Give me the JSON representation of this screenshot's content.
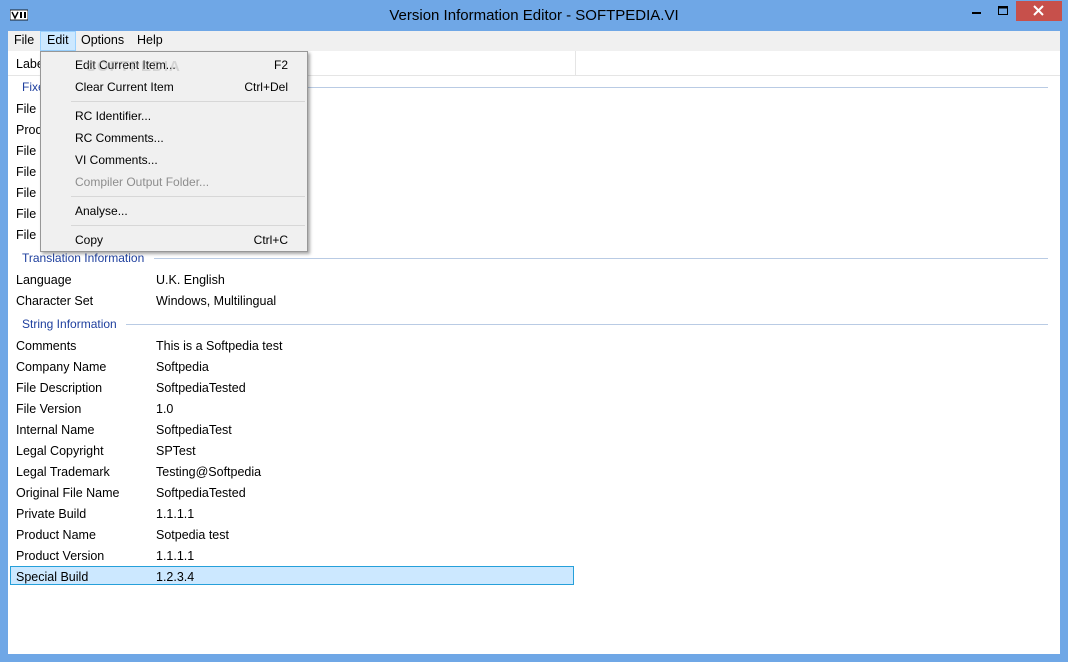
{
  "window": {
    "title": "Version Information Editor - SOFTPEDIA.VI",
    "colors": {
      "frame": "#6fa7e6",
      "close": "#c7504b",
      "group_text": "#1e3f9e",
      "selection": "#cce8ff"
    }
  },
  "menubar": {
    "items": [
      {
        "label": "File"
      },
      {
        "label": "Edit"
      },
      {
        "label": "Options"
      },
      {
        "label": "Help"
      }
    ]
  },
  "edit_menu": {
    "items": [
      {
        "label": "Edit Current Item...",
        "shortcut": "F2"
      },
      {
        "label": "Clear Current Item",
        "shortcut": "Ctrl+Del"
      },
      {
        "label": "RC Identifier...",
        "shortcut": ""
      },
      {
        "label": "RC Comments...",
        "shortcut": ""
      },
      {
        "label": "VI Comments...",
        "shortcut": ""
      },
      {
        "label": "Compiler Output Folder...",
        "shortcut": "",
        "disabled": true
      },
      {
        "label": "Analyse...",
        "shortcut": ""
      },
      {
        "label": "Copy",
        "shortcut": "Ctrl+C"
      }
    ]
  },
  "list": {
    "header_label": "Label",
    "fixed": {
      "title": "Fixed Information",
      "labels": [
        "File",
        "Product",
        "File",
        "File",
        "File",
        "File",
        "File"
      ]
    },
    "translation": {
      "title": "Translation Information",
      "rows": [
        {
          "label": "Language",
          "value": "U.K. English"
        },
        {
          "label": "Character Set",
          "value": "Windows, Multilingual"
        }
      ]
    },
    "strings": {
      "title": "String Information",
      "rows": [
        {
          "label": "Comments",
          "value": "This is a Softpedia test"
        },
        {
          "label": "Company Name",
          "value": "Softpedia"
        },
        {
          "label": "File Description",
          "value": "SoftpediaTested"
        },
        {
          "label": "File Version",
          "value": "1.0"
        },
        {
          "label": "Internal Name",
          "value": "SoftpediaTest"
        },
        {
          "label": "Legal Copyright",
          "value": "SPTest"
        },
        {
          "label": "Legal Trademark",
          "value": "Testing@Softpedia"
        },
        {
          "label": "Original File Name",
          "value": "SoftpediaTested"
        },
        {
          "label": "Private Build",
          "value": "1.1.1.1"
        },
        {
          "label": "Product Name",
          "value": "Sotpedia test"
        },
        {
          "label": "Product Version",
          "value": "1.1.1.1"
        },
        {
          "label": "Special Build",
          "value": "1.2.3.4"
        }
      ]
    }
  },
  "watermark": "SOFTPEDIA"
}
